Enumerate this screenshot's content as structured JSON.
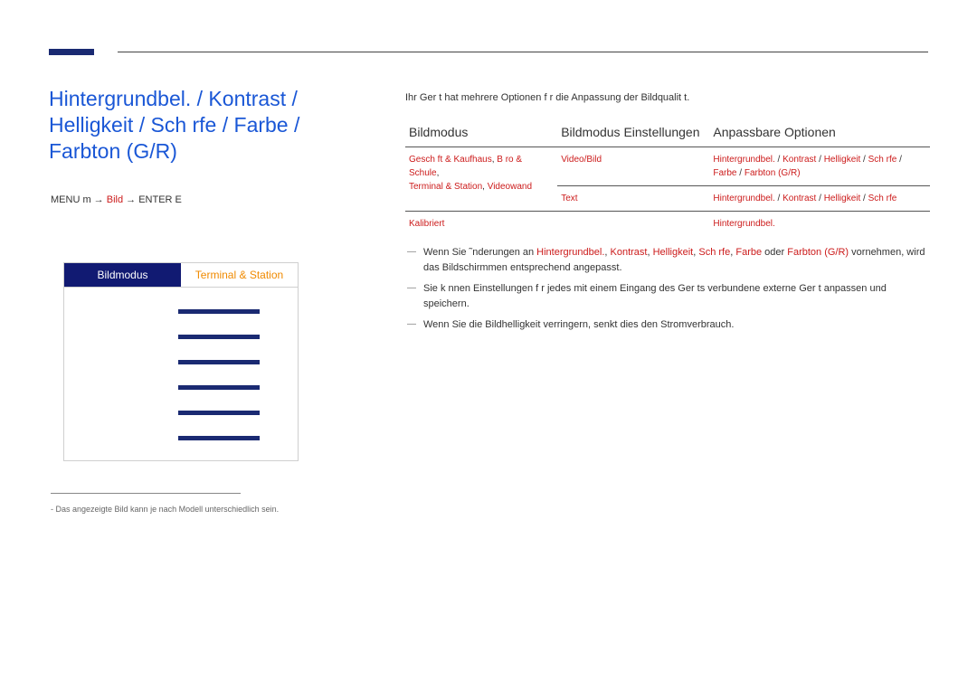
{
  "title": "Hintergrundbel. / Kontrast / Helligkeit / Sch rfe / Farbe / Farbton (G/R)",
  "menu_path": {
    "prefix": "MENU m → ",
    "red": "Bild",
    "suffix": " → ENTER E"
  },
  "device": {
    "col_left": "Bildmodus",
    "col_right": "Terminal & Station"
  },
  "footnote": "Das angezeigte Bild kann je nach Modell unterschiedlich sein.",
  "intro": "Ihr Ger t hat mehrere Optionen f r die Anpassung der Bildqualit t.",
  "table": {
    "headers": [
      "Bildmodus",
      "Bildmodus Einstellungen",
      "Anpassbare Optionen"
    ],
    "rows": [
      {
        "c1": [
          {
            "t": "Gesch ft & Kaufhaus",
            "r": 1
          },
          {
            "t": ", ",
            "r": 0
          },
          {
            "t": "B ro & Schule",
            "r": 1
          },
          {
            "t": ",",
            "r": 0
          },
          {
            "t": "\nTerminal & Station",
            "r": 1
          },
          {
            "t": ", ",
            "r": 0
          },
          {
            "t": "Videowand",
            "r": 1
          }
        ],
        "c2": [
          {
            "t": "Video/Bild",
            "r": 1
          }
        ],
        "c3": [
          {
            "t": "Hintergrundbel.",
            "r": 1
          },
          {
            "t": " / ",
            "r": 0
          },
          {
            "t": "Kontrast",
            "r": 1
          },
          {
            "t": " / ",
            "r": 0
          },
          {
            "t": "Helligkeit",
            "r": 1
          },
          {
            "t": " / ",
            "r": 0
          },
          {
            "t": "Sch rfe",
            "r": 1
          },
          {
            "t": " / ",
            "r": 0
          },
          {
            "t": "Farbe",
            "r": 1
          },
          {
            "t": " / ",
            "r": 0
          },
          {
            "t": "Farbton (G/R)",
            "r": 1
          }
        ]
      },
      {
        "c1": [],
        "c2": [
          {
            "t": "Text",
            "r": 1
          }
        ],
        "c3": [
          {
            "t": "Hintergrundbel.",
            "r": 1
          },
          {
            "t": " / ",
            "r": 0
          },
          {
            "t": "Kontrast",
            "r": 1
          },
          {
            "t": " / ",
            "r": 0
          },
          {
            "t": "Helligkeit",
            "r": 1
          },
          {
            "t": " / ",
            "r": 0
          },
          {
            "t": "Sch rfe",
            "r": 1
          }
        ]
      },
      {
        "c1": [
          {
            "t": "Kalibriert",
            "r": 1
          }
        ],
        "c2": [],
        "c3": [
          {
            "t": "Hintergrundbel.",
            "r": 1
          }
        ]
      }
    ]
  },
  "notes": [
    {
      "segs": [
        {
          "t": "Wenn Sie ˜nderungen an ",
          "r": 0
        },
        {
          "t": "Hintergrundbel.",
          "r": 1
        },
        {
          "t": ", ",
          "r": 0
        },
        {
          "t": "Kontrast",
          "r": 1
        },
        {
          "t": ", ",
          "r": 0
        },
        {
          "t": "Helligkeit",
          "r": 1
        },
        {
          "t": ", ",
          "r": 0
        },
        {
          "t": "Sch rfe",
          "r": 1
        },
        {
          "t": ", ",
          "r": 0
        },
        {
          "t": "Farbe",
          "r": 1
        },
        {
          "t": " oder ",
          "r": 0
        },
        {
          "t": "Farbton (G/R)",
          "r": 1
        },
        {
          "t": " vornehmen, wird das Bildschirmmen  entsprechend angepasst.",
          "r": 0
        }
      ]
    },
    {
      "segs": [
        {
          "t": "Sie k nnen Einstellungen f r jedes mit einem Eingang des Ger ts verbundene externe Ger t anpassen und speichern.",
          "r": 0
        }
      ]
    },
    {
      "segs": [
        {
          "t": "Wenn Sie die Bildhelligkeit verringern, senkt dies den Stromverbrauch.",
          "r": 0
        }
      ]
    }
  ]
}
